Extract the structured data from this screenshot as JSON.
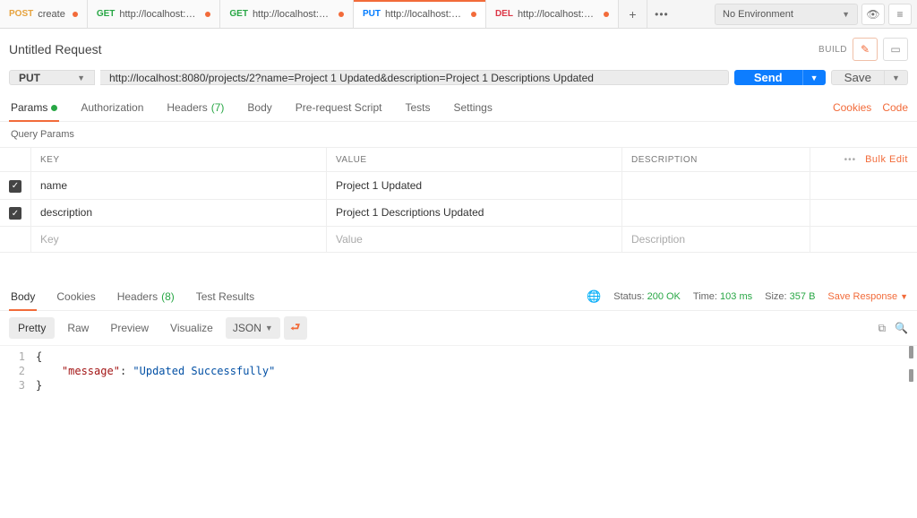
{
  "tabs": [
    {
      "method": "POST",
      "mclass": "m-post",
      "label": "create",
      "dirty": true,
      "active": false
    },
    {
      "method": "GET",
      "mclass": "m-get",
      "label": "http://localhost:80...",
      "dirty": true,
      "active": false
    },
    {
      "method": "GET",
      "mclass": "m-get",
      "label": "http://localhost:80...",
      "dirty": true,
      "active": false
    },
    {
      "method": "PUT",
      "mclass": "m-put",
      "label": "http://localhost:80...",
      "dirty": true,
      "active": true
    },
    {
      "method": "DEL",
      "mclass": "m-del",
      "label": "http://localhost:80...",
      "dirty": true,
      "active": false
    }
  ],
  "env": {
    "selected": "No Environment"
  },
  "request": {
    "name": "Untitled Request",
    "build": "BUILD",
    "method": "PUT",
    "url": "http://localhost:8080/projects/2?name=Project 1 Updated&description=Project 1 Descriptions Updated",
    "send": "Send",
    "save": "Save"
  },
  "reqTabs": {
    "params": "Params",
    "auth": "Authorization",
    "headers": "Headers",
    "headersCount": "(7)",
    "body": "Body",
    "prereq": "Pre-request Script",
    "tests": "Tests",
    "settings": "Settings",
    "cookies": "Cookies",
    "code": "Code"
  },
  "queryParams": {
    "title": "Query Params",
    "headers": {
      "key": "KEY",
      "value": "VALUE",
      "desc": "DESCRIPTION"
    },
    "bulkEdit": "Bulk Edit",
    "rows": [
      {
        "checked": true,
        "key": "name",
        "value": "Project 1 Updated",
        "desc": ""
      },
      {
        "checked": true,
        "key": "description",
        "value": "Project 1 Descriptions Updated",
        "desc": ""
      }
    ],
    "placeholders": {
      "key": "Key",
      "value": "Value",
      "desc": "Description"
    }
  },
  "respTabs": {
    "body": "Body",
    "cookies": "Cookies",
    "headers": "Headers",
    "headersCount": "(8)",
    "tests": "Test Results"
  },
  "status": {
    "labelStatus": "Status:",
    "statusValue": "200 OK",
    "labelTime": "Time:",
    "timeValue": "103 ms",
    "labelSize": "Size:",
    "sizeValue": "357 B",
    "saveResponse": "Save Response"
  },
  "bodyBar": {
    "pretty": "Pretty",
    "raw": "Raw",
    "preview": "Preview",
    "visualize": "Visualize",
    "format": "JSON"
  },
  "responseBody": {
    "line1": "{",
    "line2_key": "\"message\"",
    "line2_colon": ": ",
    "line2_val": "\"Updated Successfully\"",
    "line3": "}"
  }
}
